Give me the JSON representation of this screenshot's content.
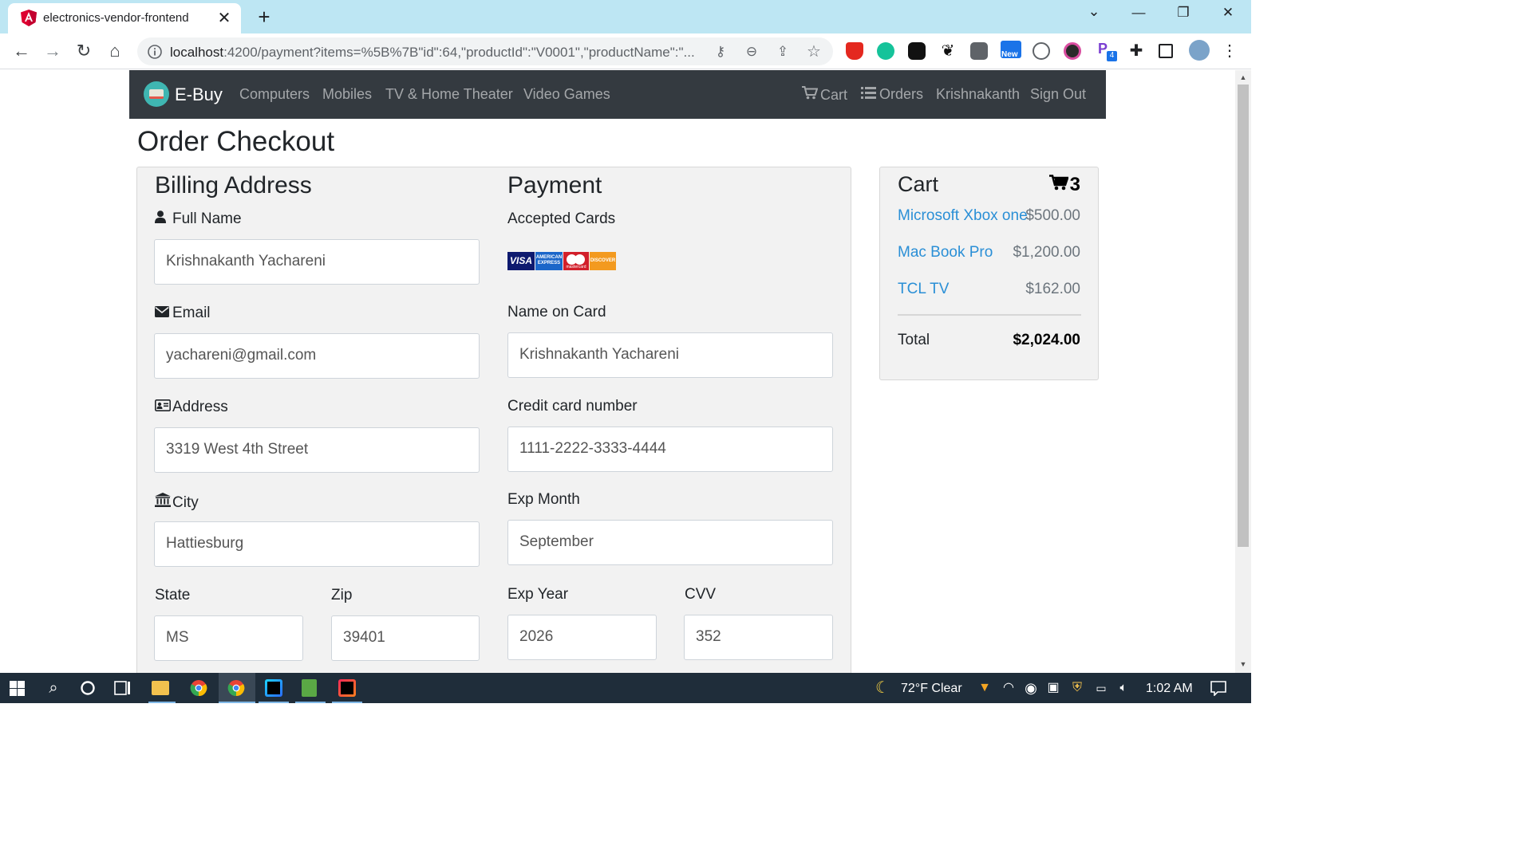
{
  "browser": {
    "tab_title": "electronics-vendor-frontend",
    "tab_close": "✕",
    "new_tab": "+",
    "url_host": "localhost",
    "url_rest": ":4200/payment?items=%5B%7B\"id\":64,\"productId\":\"V0001\",\"productName\":\"...",
    "window_controls": {
      "minimize": "—",
      "restore": "❐",
      "close": "✕",
      "tab_search": "⌄"
    },
    "nav": {
      "back": "←",
      "forward": "→",
      "reload": "↻",
      "home": "⌂"
    },
    "omnibox_icons": {
      "key": "⚷",
      "zoom": "⊖",
      "share": "⇪",
      "star": "☆"
    }
  },
  "navbar": {
    "brand": "E-Buy",
    "links": [
      "Computers",
      "Mobiles",
      "TV & Home Theater",
      "Video Games"
    ],
    "right_links": {
      "cart": "Cart",
      "orders": "Orders",
      "user": "Krishnakanth",
      "signout": "Sign Out"
    }
  },
  "page": {
    "title": "Order Checkout"
  },
  "billing": {
    "heading": "Billing Address",
    "full_name_label": "Full Name",
    "full_name_value": "Krishnakanth Yachareni",
    "email_label": "Email",
    "email_value": "yachareni@gmail.com",
    "address_label": "Address",
    "address_value": "3319 West 4th Street",
    "city_label": "City",
    "city_value": "Hattiesburg",
    "state_label": "State",
    "state_value": "MS",
    "zip_label": "Zip",
    "zip_value": "39401"
  },
  "payment": {
    "heading": "Payment",
    "accepted_cards_label": "Accepted Cards",
    "cards": [
      "VISA",
      "AMERICAN EXPRESS",
      "mastercard",
      "DISCOVER"
    ],
    "name_on_card_label": "Name on Card",
    "name_on_card_value": "Krishnakanth Yachareni",
    "card_number_label": "Credit card number",
    "card_number_value": "1111-2222-3333-4444",
    "exp_month_label": "Exp Month",
    "exp_month_value": "September",
    "exp_year_label": "Exp Year",
    "exp_year_value": "2026",
    "cvv_label": "CVV",
    "cvv_value": "352"
  },
  "cart": {
    "title": "Cart",
    "count": "3",
    "items": [
      {
        "name": "Microsoft Xbox one",
        "price": "$500.00"
      },
      {
        "name": "Mac Book Pro",
        "price": "$1,200.00"
      },
      {
        "name": "TCL TV",
        "price": "$162.00"
      }
    ],
    "total_label": "Total",
    "total_value": "$2,024.00"
  },
  "taskbar": {
    "weather": "72°F  Clear",
    "time": "1:02 AM",
    "ext_badge_new": "New",
    "ext_badge_count": "4"
  },
  "colors": {
    "navbar_bg": "#343a40",
    "panel_bg": "#f2f2f2",
    "link_blue": "#2a8fd6",
    "tabstrip_bg": "#bde6f3",
    "taskbar_bg": "#1f2d3a"
  }
}
